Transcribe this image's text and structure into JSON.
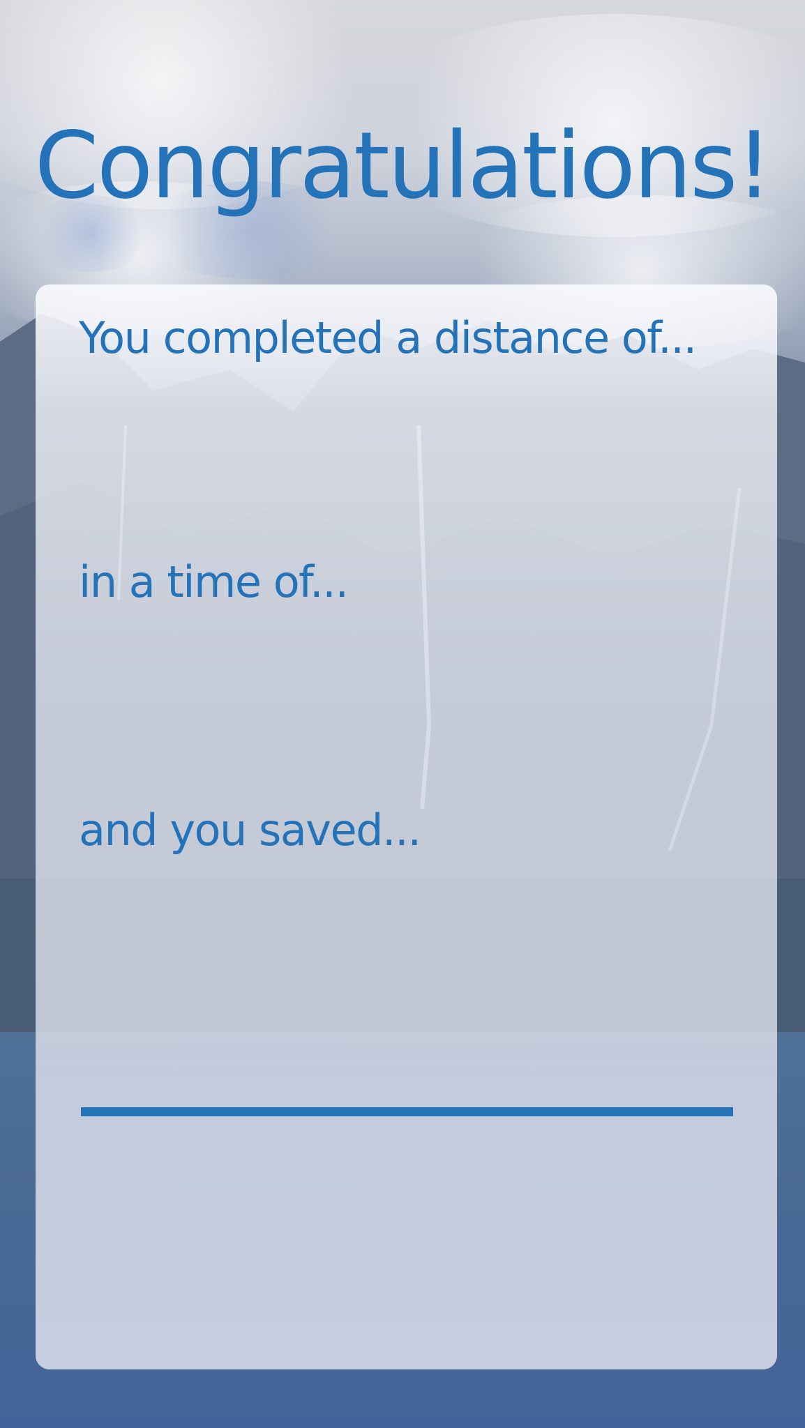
{
  "header": {
    "title": "Congratulations!"
  },
  "card": {
    "distance_prompt": "You completed a distance of...",
    "time_prompt": "in a time of...",
    "saved_prompt": "and you saved..."
  },
  "colors": {
    "accent": "#2473b9",
    "card_background": "#eceef4"
  }
}
